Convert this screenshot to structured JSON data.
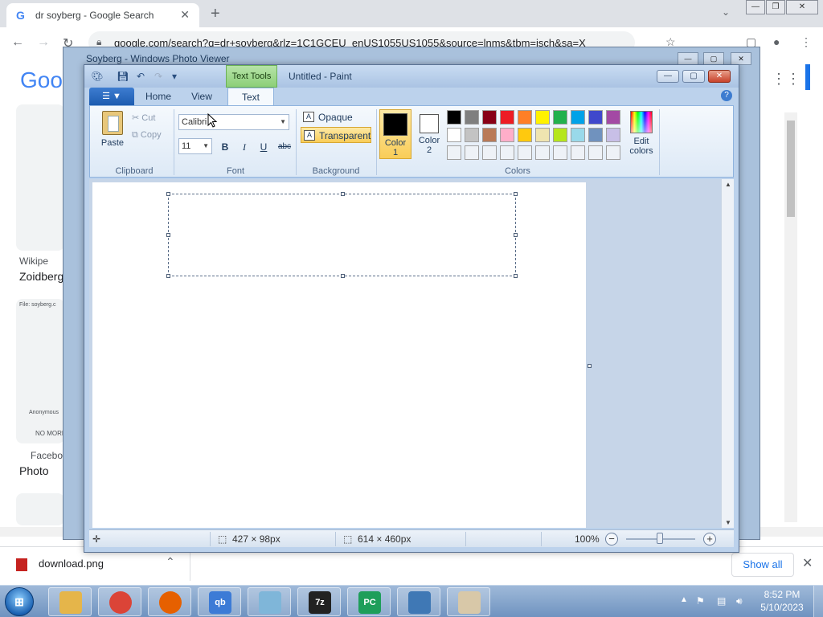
{
  "chrome": {
    "tab_title": "dr soyberg - Google Search",
    "tab_favicon": "G",
    "close_tab": "✕",
    "new_tab": "+",
    "url": "google.com/search?q=dr+soyberg&rlz=1C1GCEU_enUS1055US1055&source=lnms&tbm=isch&sa=X",
    "logo": "Goo",
    "results": [
      {
        "source": "Wikipe",
        "title": "Zoidberg"
      },
      {
        "file_label": "File: soyberg.c",
        "caption": "Anonymous",
        "more": "NO MORE"
      },
      {
        "source": "Faceboo",
        "title": "Photo"
      }
    ]
  },
  "downloads": {
    "file_name": "download.png",
    "show_all": "Show all",
    "close": "✕"
  },
  "photo_viewer": {
    "title": "Soyberg - Windows Photo Viewer"
  },
  "paint": {
    "context_tab": "Text Tools",
    "title": "Untitled - Paint",
    "file_menu": "▼",
    "tabs": [
      "Home",
      "View",
      "Text"
    ],
    "active_tab": "Text",
    "help": "?",
    "clipboard": {
      "paste": "Paste",
      "cut": "Cut",
      "copy": "Copy",
      "group": "Clipboard"
    },
    "font": {
      "family": "Calibri",
      "size": "11",
      "bold": "B",
      "italic": "I",
      "underline": "U",
      "strike": "abc",
      "group": "Font"
    },
    "background": {
      "opaque": "Opaque",
      "transparent": "Transparent",
      "group": "Background",
      "selected": "Transparent"
    },
    "colors": {
      "color1_label": "Color 1",
      "color1_line1": "Color",
      "color1_line2": "1",
      "color2_line1": "Color",
      "color2_line2": "2",
      "color1_value": "#000000",
      "color2_value": "#ffffff",
      "edit_line1": "Edit",
      "edit_line2": "colors",
      "group": "Colors",
      "palette_row1": [
        "#000000",
        "#7f7f7f",
        "#880015",
        "#ed1c24",
        "#ff7f27",
        "#fff200",
        "#22b14c",
        "#00a2e8",
        "#3f48cc",
        "#a349a4"
      ],
      "palette_row2": [
        "#ffffff",
        "#c3c3c3",
        "#b97a57",
        "#ffaec9",
        "#ffc90e",
        "#efe4b0",
        "#b5e61d",
        "#99d9ea",
        "#7092be",
        "#c8bfe7"
      ]
    },
    "status": {
      "selection_size": "427 × 98px",
      "image_size": "614 × 460px",
      "zoom": "100%"
    }
  },
  "taskbar": {
    "apps": [
      {
        "name": "file-explorer",
        "label": ""
      },
      {
        "name": "chrome",
        "label": ""
      },
      {
        "name": "firefox",
        "label": ""
      },
      {
        "name": "qbittorrent",
        "label": "qb"
      },
      {
        "name": "notepad",
        "label": ""
      },
      {
        "name": "7zip",
        "label": "7z"
      },
      {
        "name": "pycharm",
        "label": "PC"
      },
      {
        "name": "photo-viewer",
        "label": ""
      },
      {
        "name": "paint",
        "label": ""
      }
    ],
    "time": "8:52 PM",
    "date": "5/10/2023"
  }
}
